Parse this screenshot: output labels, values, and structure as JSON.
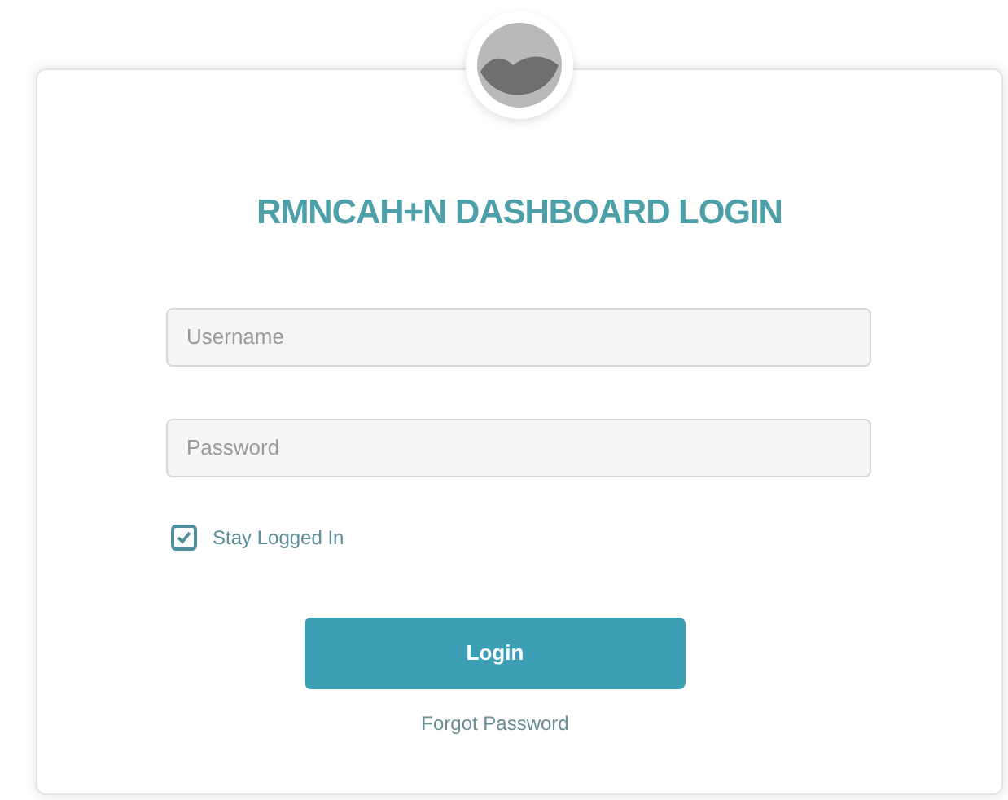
{
  "title": "RMNCAH+N DASHBOARD LOGIN",
  "fields": [
    {
      "placeholder": "Username"
    },
    {
      "placeholder": "Password"
    }
  ],
  "stay_logged_in": {
    "label": "Stay Logged In",
    "checked": true
  },
  "login_button": "Login",
  "forgot_link": "Forgot Password"
}
